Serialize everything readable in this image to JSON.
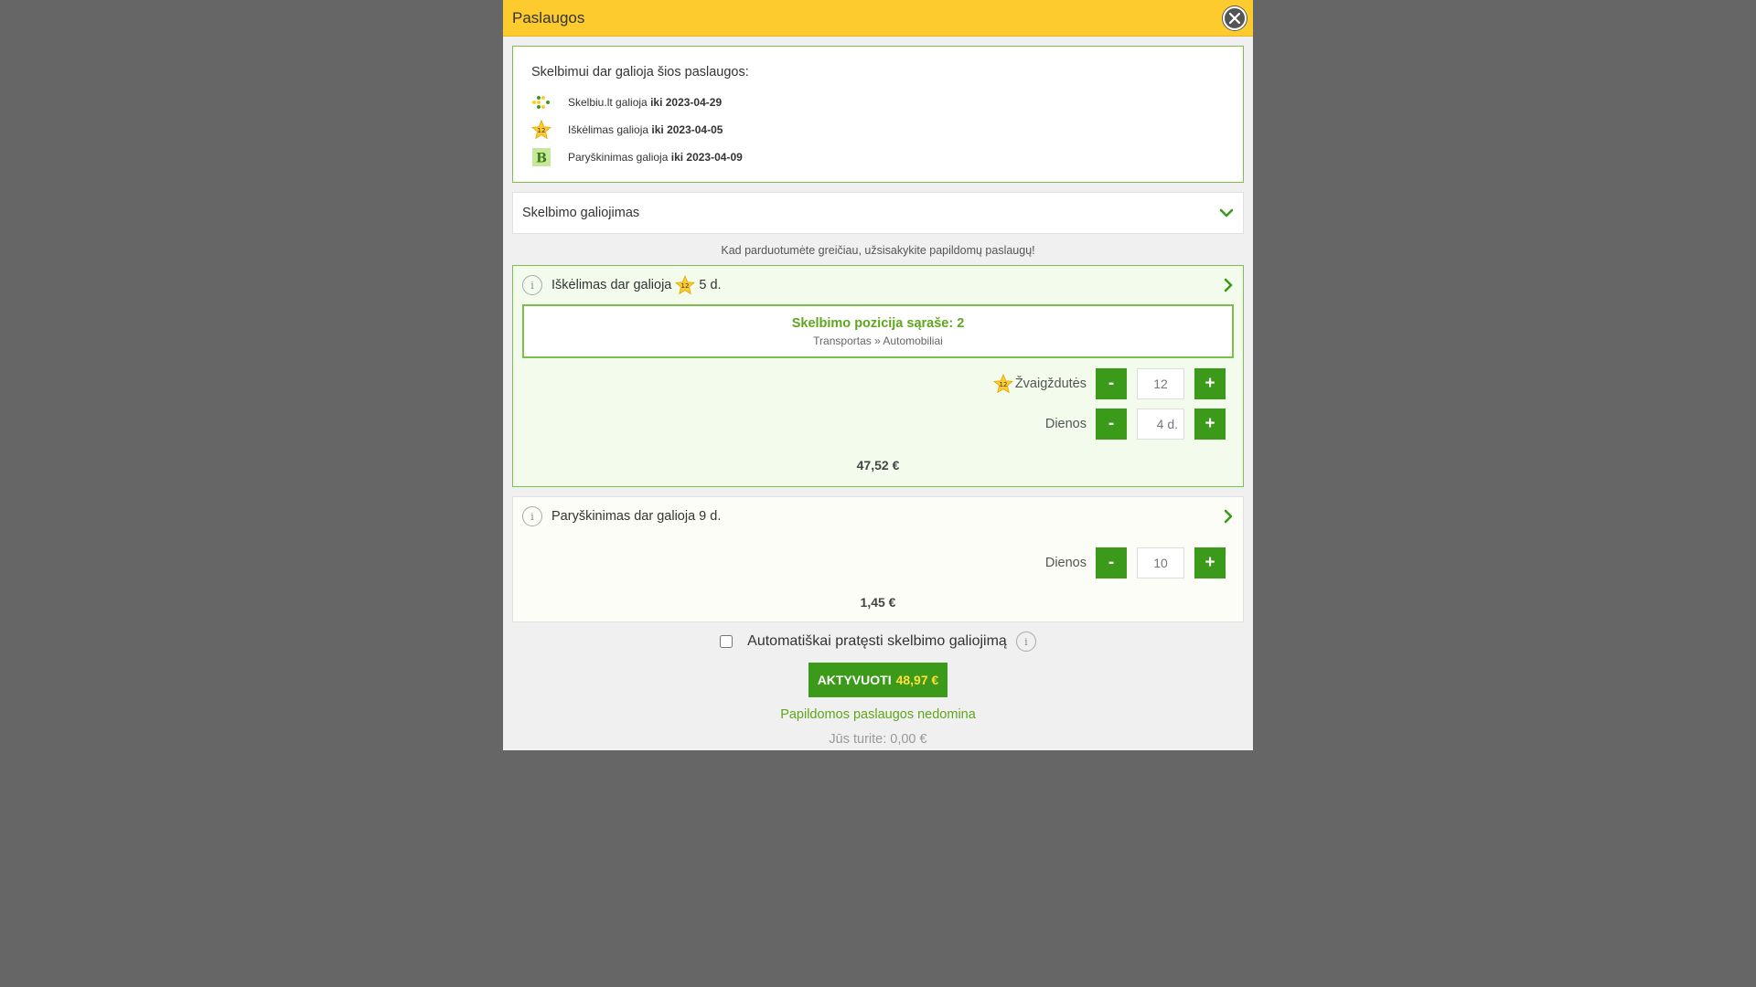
{
  "modal": {
    "title": "Paslaugos",
    "close_icon": "close-icon"
  },
  "active_services": {
    "heading": "Skelbimui dar galioja šios paslaugos:",
    "items": [
      {
        "label": "Skelbiu.lt galioja",
        "until": "iki 2023-04-29",
        "icon": "skelbiu-logo-icon"
      },
      {
        "label": "Iškėlimas galioja",
        "until": "iki 2023-04-05",
        "icon": "star-12-icon"
      },
      {
        "label": "Paryškinimas galioja",
        "until": "iki 2023-04-09",
        "icon": "bold-b-icon"
      }
    ]
  },
  "validity": {
    "label": "Skelbimo galiojimas",
    "icon": "chevron-down-icon"
  },
  "promo": "Kad parduotumėte greičiau, užsisakykite papildomų paslaugų!",
  "highlight": {
    "title_prefix": "Iškėlimas dar galioja",
    "title_suffix": "5 d.",
    "position_title": "Skelbimo pozicija sąraše: 2",
    "position_path": "Transportas » Automobiliai",
    "stars_label": "Žvaigždutės",
    "stars_value": "12",
    "days_label": "Dienos",
    "days_value": "4 d.",
    "price": "47,52 €",
    "minus": "-",
    "plus": "+"
  },
  "bold": {
    "title": "Paryškinimas dar galioja 9 d.",
    "days_label": "Dienos",
    "days_value": "10",
    "price": "1,45 €",
    "minus": "-",
    "plus": "+"
  },
  "auto_renew": {
    "label": "Automatiškai pratęsti skelbimo galiojimą",
    "checked": false
  },
  "activate": {
    "label": "AKTYVUOTI",
    "amount": "48,97 €"
  },
  "decline": "Papildomos paslaugos nedomina",
  "balance": "Jūs turite: 0,00 €",
  "colors": {
    "header": "#fdcb2e",
    "green": "#3c9a1a",
    "green_text": "#5fa61d",
    "border_green": "#7cbf4a",
    "overlay": "#666666"
  }
}
